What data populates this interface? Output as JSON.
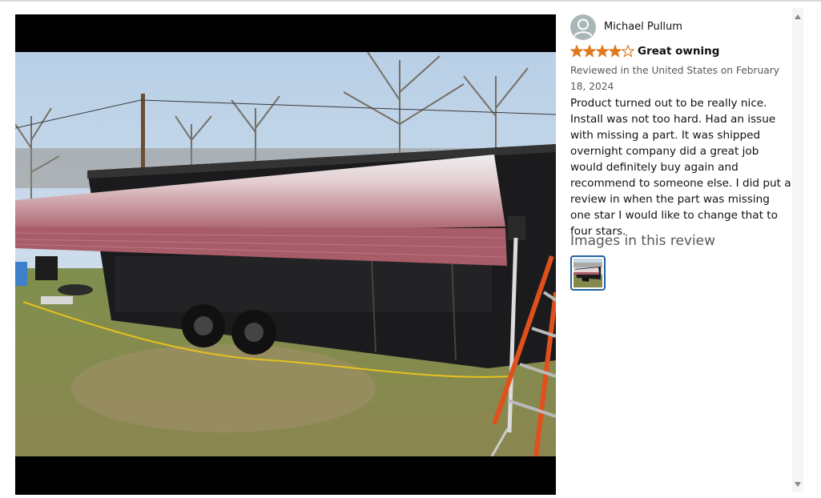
{
  "review": {
    "reviewer_name": "Michael Pullum",
    "rating": 4,
    "rating_max": 5,
    "title": "Great owning",
    "meta": "Reviewed in the United States on February 18, 2024",
    "body": "Product turned out to be really nice. Install was not too hard. Had an issue with missing a part. It was shipped overnight company did a great job would definitely buy again and recommend to someone else. I did put a review in when the part was missing one star I would like to change that to four stars.",
    "images_heading": "Images in this review",
    "image_count": 1
  },
  "colors": {
    "star": "#de7921",
    "text_primary": "#0f1111",
    "text_secondary": "#565959",
    "thumb_border": "#2162a1",
    "awning": "#a75c68"
  },
  "icons": {
    "avatar": "user-avatar-icon",
    "scroll_up": "triangle-up-icon",
    "scroll_down": "triangle-down-icon"
  }
}
